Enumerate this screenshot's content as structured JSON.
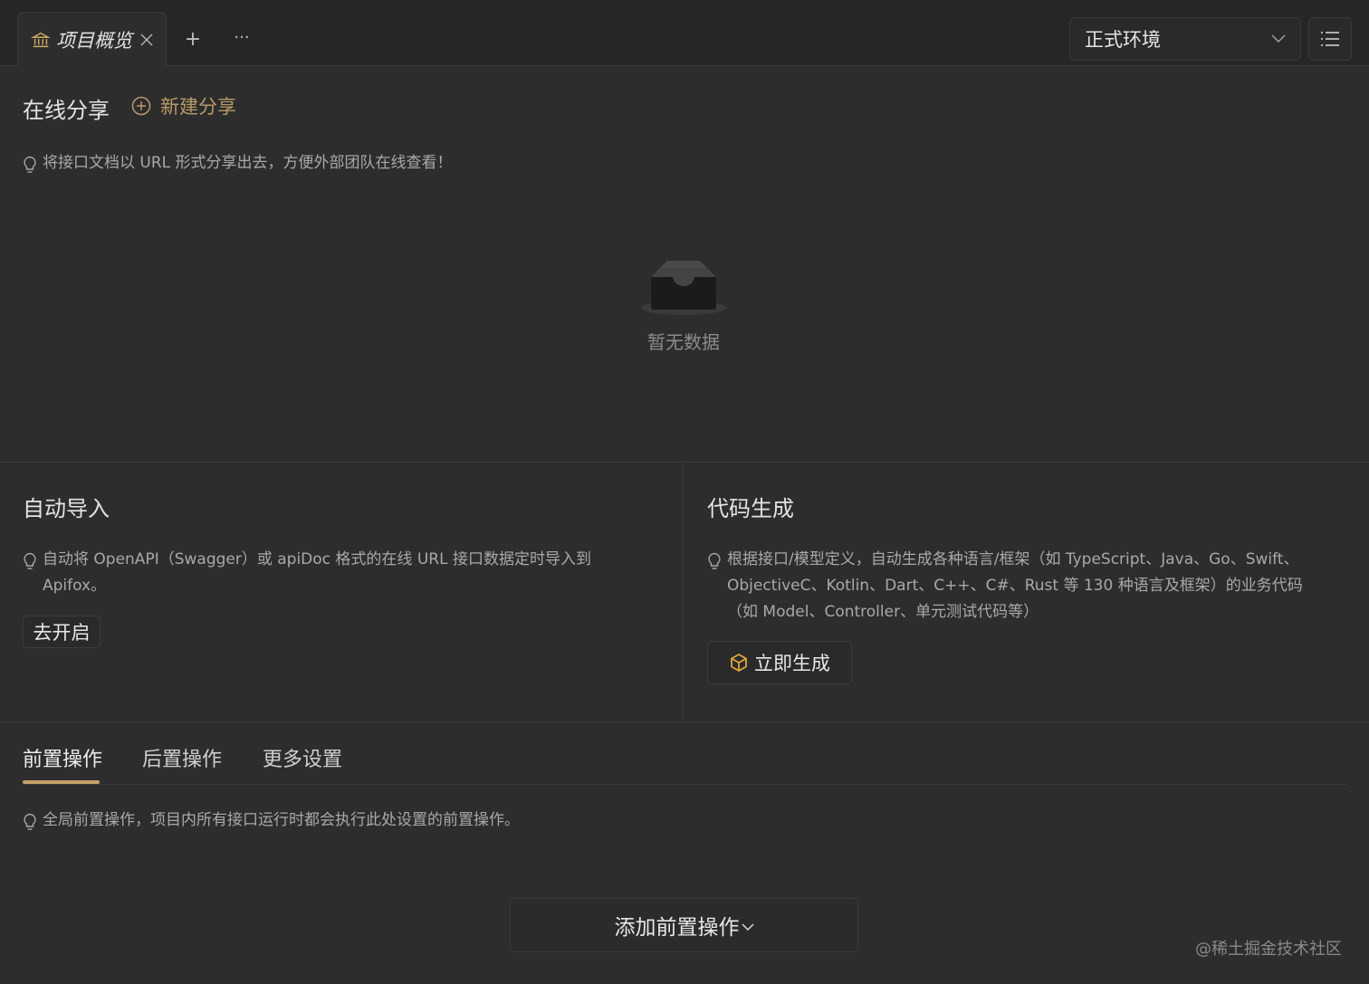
{
  "topbar": {
    "tab_label": "项目概览",
    "add_tab": "+",
    "more": "···",
    "environment": "正式环境"
  },
  "share": {
    "title": "在线分享",
    "new_share": "新建分享",
    "tip": "将接口文档以 URL 形式分享出去，方便外部团队在线查看！",
    "empty": "暂无数据"
  },
  "auto_import": {
    "title": "自动导入",
    "tip": "自动将 OpenAPI（Swagger）或 apiDoc 格式的在线 URL 接口数据定时导入到 Apifox。",
    "button": "去开启"
  },
  "codegen": {
    "title": "代码生成",
    "tip": "根据接口/模型定义，自动生成各种语言/框架（如 TypeScript、Java、Go、Swift、ObjectiveC、Kotlin、Dart、C++、C#、Rust 等 130 种语言及框架）的业务代码（如 Model、Controller、单元测试代码等）",
    "button": "立即生成"
  },
  "operations": {
    "tabs": [
      "前置操作",
      "后置操作",
      "更多设置"
    ],
    "active_tab": "前置操作",
    "tip": "全局前置操作，项目内所有接口运行时都会执行此处设置的前置操作。",
    "add_button": "添加前置操作"
  },
  "watermark": "@稀土掘金技术社区",
  "colors": {
    "background": "#2d2d2d",
    "accent": "#c4a06b",
    "generate_icon": "#e0a63a"
  }
}
